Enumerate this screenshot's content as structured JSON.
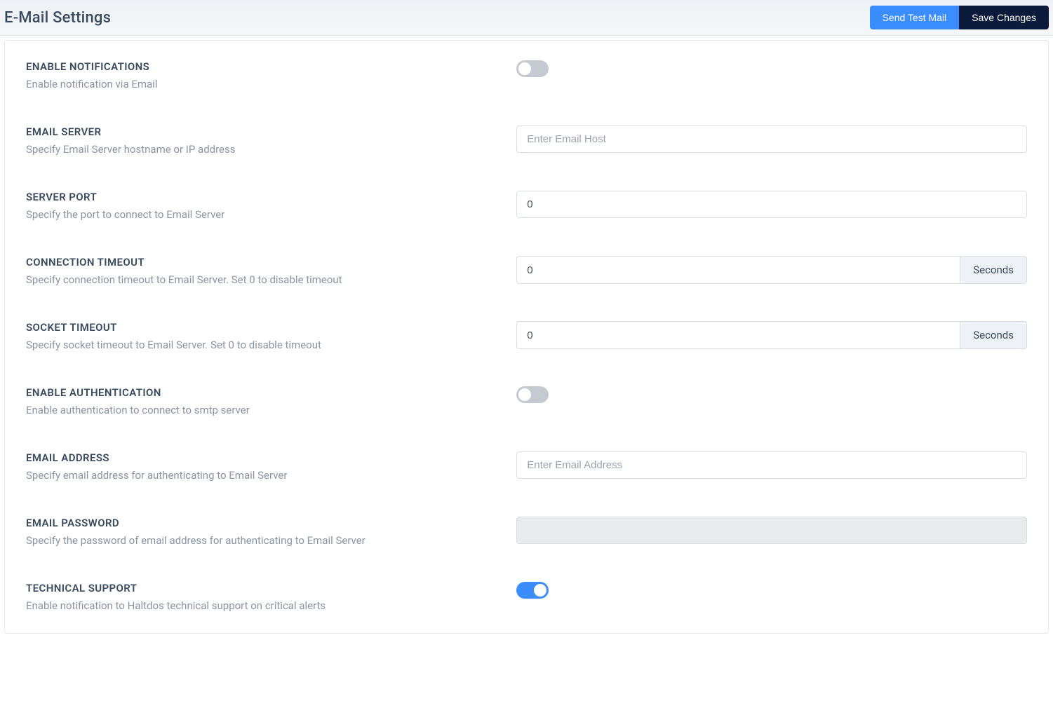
{
  "header": {
    "title": "E-Mail Settings",
    "send_test_label": "Send Test Mail",
    "save_label": "Save Changes"
  },
  "fields": {
    "enable_notifications": {
      "label": "ENABLE NOTIFICATIONS",
      "desc": "Enable notification via Email",
      "value": false
    },
    "email_server": {
      "label": "EMAIL SERVER",
      "desc": "Specify Email Server hostname or IP address",
      "placeholder": "Enter Email Host",
      "value": ""
    },
    "server_port": {
      "label": "SERVER PORT",
      "desc": "Specify the port to connect to Email Server",
      "value": "0"
    },
    "connection_timeout": {
      "label": "CONNECTION TIMEOUT",
      "desc": "Specify connection timeout to Email Server. Set 0 to disable timeout",
      "value": "0",
      "unit": "Seconds"
    },
    "socket_timeout": {
      "label": "SOCKET TIMEOUT",
      "desc": "Specify socket timeout to Email Server. Set 0 to disable timeout",
      "value": "0",
      "unit": "Seconds"
    },
    "enable_auth": {
      "label": "ENABLE AUTHENTICATION",
      "desc": "Enable authentication to connect to smtp server",
      "value": false
    },
    "email_address": {
      "label": "EMAIL ADDRESS",
      "desc": "Specify email address for authenticating to Email Server",
      "placeholder": "Enter Email Address",
      "value": ""
    },
    "email_password": {
      "label": "EMAIL PASSWORD",
      "desc": "Specify the password of email address for authenticating to Email Server",
      "value": ""
    },
    "technical_support": {
      "label": "TECHNICAL SUPPORT",
      "desc": "Enable notification to Haltdos technical support on critical alerts",
      "value": true
    }
  }
}
